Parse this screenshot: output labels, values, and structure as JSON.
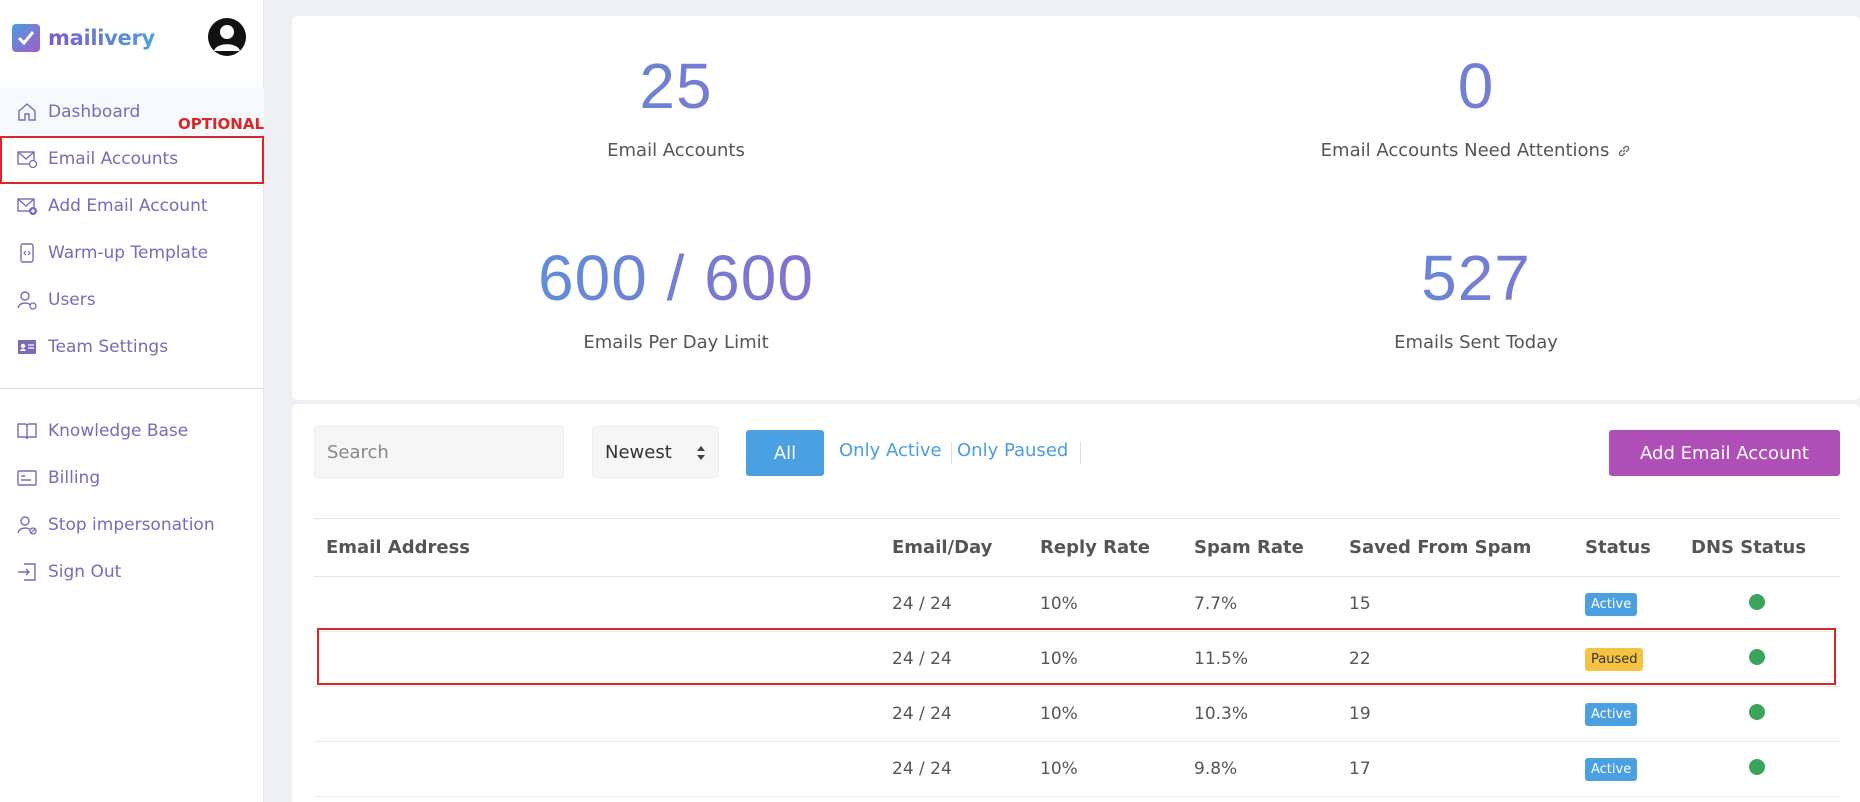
{
  "brand": {
    "name": "mailivery"
  },
  "sidebar": {
    "items": [
      {
        "label": "Dashboard",
        "icon": "home-icon"
      },
      {
        "label": "Email Accounts",
        "icon": "mail-at-icon"
      },
      {
        "label": "Add Email Account",
        "icon": "mail-plus-icon"
      },
      {
        "label": "Warm-up Template",
        "icon": "code-file-icon"
      },
      {
        "label": "Users",
        "icon": "user-gear-icon"
      },
      {
        "label": "Team Settings",
        "icon": "id-card-icon"
      }
    ],
    "secondary": [
      {
        "label": "Knowledge Base",
        "icon": "book-icon"
      },
      {
        "label": "Billing",
        "icon": "credit-card-icon"
      },
      {
        "label": "Stop impersonation",
        "icon": "user-stop-icon"
      },
      {
        "label": "Sign Out",
        "icon": "sign-out-icon"
      }
    ],
    "optional_tag": "OPTIONAL"
  },
  "stats": [
    {
      "value": "25",
      "label": "Email Accounts"
    },
    {
      "value": "0",
      "label": "Email Accounts Need Attentions"
    },
    {
      "value": "600 / 600",
      "label": "Emails Per Day Limit"
    },
    {
      "value": "527",
      "label": "Emails Sent Today"
    }
  ],
  "toolbar": {
    "search_placeholder": "Search",
    "sort_value": "Newest",
    "filter_all": "All",
    "filter_active": "Only Active",
    "filter_paused": "Only Paused",
    "add_button": "Add Email Account"
  },
  "table": {
    "headers": [
      "Email Address",
      "Email/Day",
      "Reply Rate",
      "Spam Rate",
      "Saved From Spam",
      "Status",
      "DNS Status"
    ],
    "rows": [
      {
        "email": "",
        "per_day": "24 / 24",
        "reply_rate": "10%",
        "spam_rate": "7.7%",
        "saved": "15",
        "status": "Active",
        "dns": "ok"
      },
      {
        "email": "",
        "per_day": "24 / 24",
        "reply_rate": "10%",
        "spam_rate": "11.5%",
        "saved": "22",
        "status": "Paused",
        "dns": "ok"
      },
      {
        "email": "",
        "per_day": "24 / 24",
        "reply_rate": "10%",
        "spam_rate": "10.3%",
        "saved": "19",
        "status": "Active",
        "dns": "ok"
      },
      {
        "email": "",
        "per_day": "24 / 24",
        "reply_rate": "10%",
        "spam_rate": "9.8%",
        "saved": "17",
        "status": "Active",
        "dns": "ok"
      }
    ]
  },
  "colors": {
    "accent": "#4aa0e0",
    "brand_purple": "#b04eb7",
    "highlight": "#d8262b",
    "dns_ok": "#3aa55a"
  }
}
